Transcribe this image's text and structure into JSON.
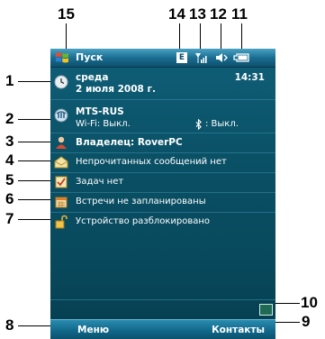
{
  "callouts": {
    "n1": "1",
    "n2": "2",
    "n3": "3",
    "n4": "4",
    "n5": "5",
    "n6": "6",
    "n7": "7",
    "n8": "8",
    "n9": "9",
    "n10": "10",
    "n11": "11",
    "n12": "12",
    "n13": "13",
    "n14": "14",
    "n15": "15"
  },
  "status_bar": {
    "start_label": "Пуск",
    "connection_badge": "E",
    "icons": [
      "windows-start-icon",
      "edge-connection-icon",
      "signal-icon",
      "volume-icon",
      "battery-icon"
    ]
  },
  "today": {
    "date": {
      "weekday": "среда",
      "date": "2 июля 2008 г.",
      "time": "14:31"
    },
    "network": {
      "operator": "MTS-RUS",
      "wifi": "Wi-Fi: Выкл.",
      "bluetooth": ": Выкл."
    },
    "owner": "Владелец: RoverPC",
    "messages": "Непрочитанных сообщений нет",
    "tasks": "Задач нет",
    "appointments": "Встречи не запланированы",
    "device_lock": "Устройство разблокировано"
  },
  "softkeys": {
    "left": "Меню",
    "right": "Контакты"
  },
  "colors": {
    "background_top": "#0f5f78",
    "background_bottom": "#063d4f",
    "bar_top": "#4aa3c4",
    "bar_bottom": "#0e4f6c",
    "text": "#ffffff"
  }
}
